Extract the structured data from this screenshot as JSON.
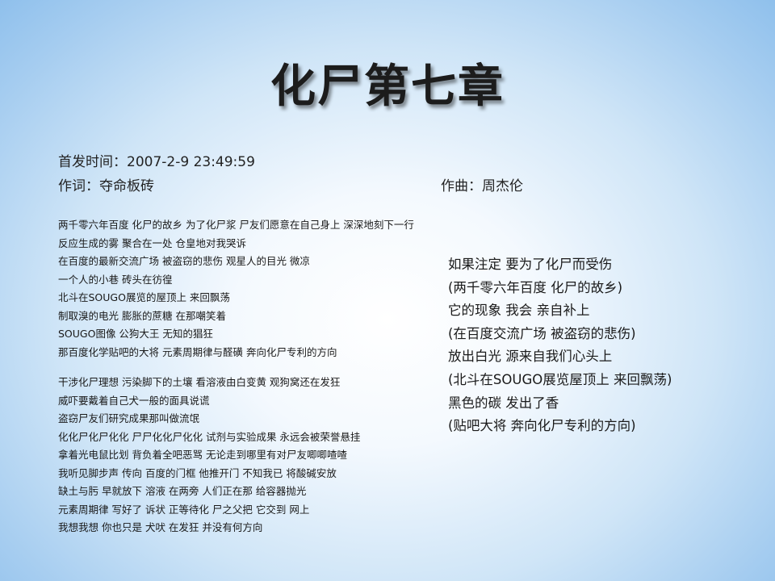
{
  "slide": {
    "title": "化尸第七章",
    "date": "首发时间：2007-2-9  23:49:59",
    "lyricist": "作词：夺命板砖",
    "composer": "作曲：周杰伦"
  },
  "lyrics_left": {
    "verse1": [
      "两千零六年百度 化尸的故乡 为了化尸浆 尸友们愿意在自己身上 深深地刻下一行",
      "反应生成的雾 聚合在一处 仓皇地对我哭诉",
      "在百度的最新交流广场 被盗窃的悲伤 观星人的目光 微凉",
      "一个人的小巷 砖头在彷徨",
      "北斗在SOUGO展览的屋顶上 来回飘荡",
      "制取溴的电光 膨胀的蔗糖 在那嘲笑着",
      "SOUGO图像 公狗大王 无知的猖狂",
      "那百度化学贴吧的大将 元素周期律与醛磺 奔向化尸专利的方向"
    ],
    "verse2": [
      "干涉化尸理想 污染脚下的土壤 看溶液由白变黄 观狗窝还在发狂",
      "威吓要戴着自己犬一般的面具说谎",
      "盗窃尸友们研究成果那叫做流氓",
      "化化尸化尸化化 尸尸化化尸化化 试剂与实验成果 永远会被荣誉悬挂",
      "拿着光电鼠比划 背负着全吧恶骂 无论走到哪里有对尸友唧唧喳喳",
      "我听见脚步声 传向 百度的门框 他推开门 不知我已 将酸碱安放",
      "缺土与肟 早就放下 溶液 在两旁 人们正在那 给容器抛光",
      "元素周期律 写好了 诉状 正等待化 尸之父把 它交到 网上",
      "我想我想 你也只是 犬吠 在发狂 并没有何方向"
    ]
  },
  "lyrics_right": [
    "如果注定 要为了化尸而受伤",
    "(两千零六年百度 化尸的故乡)",
    "它的现象 我会 亲自补上",
    "(在百度交流广场 被盗窃的悲伤)",
    "放出白光 源来自我们心头上",
    "(北斗在SOUGO展览屋顶上 来回飘荡)",
    "黑色的碳 发出了香",
    "(贴吧大将 奔向化尸专利的方向)"
  ]
}
